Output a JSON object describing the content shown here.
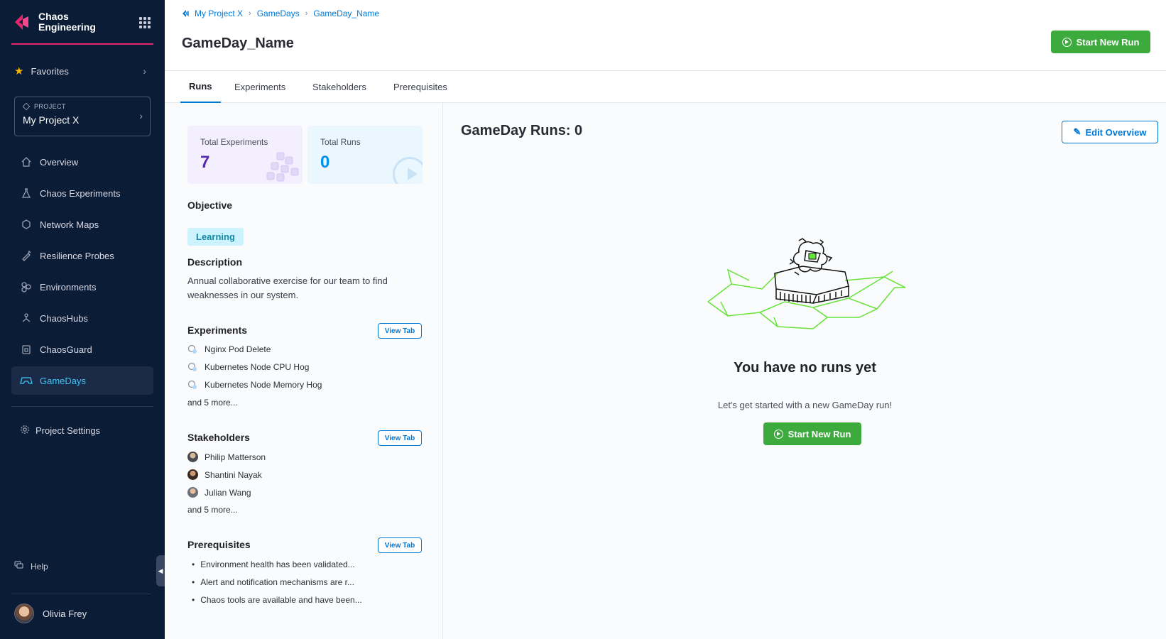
{
  "sidebar": {
    "brand": {
      "line1": "Chaos",
      "line2": "Engineering"
    },
    "favorites_label": "Favorites",
    "project": {
      "label": "PROJECT",
      "value": "My Project X"
    },
    "items": [
      {
        "label": "Overview",
        "icon": "home-icon"
      },
      {
        "label": "Chaos Experiments",
        "icon": "flask-icon"
      },
      {
        "label": "Network Maps",
        "icon": "hexagon-icon"
      },
      {
        "label": "Resilience Probes",
        "icon": "probe-icon"
      },
      {
        "label": "Environments",
        "icon": "environments-icon"
      },
      {
        "label": "ChaosHubs",
        "icon": "hub-icon"
      },
      {
        "label": "ChaosGuard",
        "icon": "guard-icon"
      },
      {
        "label": "GameDays",
        "icon": "gamepad-icon",
        "active": true
      }
    ],
    "settings_label": "Project Settings",
    "help_label": "Help",
    "user_name": "Olivia Frey"
  },
  "header": {
    "breadcrumbs": [
      "My Project X",
      "GameDays",
      "GameDay_Name"
    ],
    "title": "GameDay_Name",
    "start_button": "Start New Run"
  },
  "tabs": [
    "Runs",
    "Experiments",
    "Stakeholders",
    "Prerequisites"
  ],
  "stats": {
    "experiments": {
      "label": "Total Experiments",
      "value": "7"
    },
    "runs": {
      "label": "Total Runs",
      "value": "0"
    }
  },
  "objective": {
    "title": "Objective",
    "badge": "Learning"
  },
  "description": {
    "title": "Description",
    "text": "Annual collaborative exercise for our team to find weaknesses in our system."
  },
  "experiments": {
    "title": "Experiments",
    "view_tab": "View Tab",
    "items": [
      "Nginx Pod Delete",
      "Kubernetes Node CPU Hog",
      "Kubernetes Node Memory Hog"
    ],
    "more": "and 5 more..."
  },
  "stakeholders": {
    "title": "Stakeholders",
    "view_tab": "View Tab",
    "items": [
      "Philip Matterson",
      "Shantini Nayak",
      "Julian Wang"
    ],
    "more": "and 5 more..."
  },
  "prerequisites": {
    "title": "Prerequisites",
    "view_tab": "View Tab",
    "items": [
      "Environment health has been validated...",
      "Alert and notification mechanisms are r...",
      "Chaos tools are available and have been..."
    ]
  },
  "main": {
    "runs_title": "GameDay Runs: 0",
    "edit_button": "Edit Overview",
    "empty_title": "You have no runs yet",
    "empty_subtitle": "Let's get started with a new GameDay run!",
    "empty_button": "Start New Run"
  },
  "colors": {
    "sidebar_bg": "#0b1c36",
    "accent_pink": "#e3266c",
    "primary_green": "#3daa3d",
    "link_blue": "#0278d5",
    "active_nav": "#3dc7f6",
    "badge_bg": "#cdf4fe"
  }
}
